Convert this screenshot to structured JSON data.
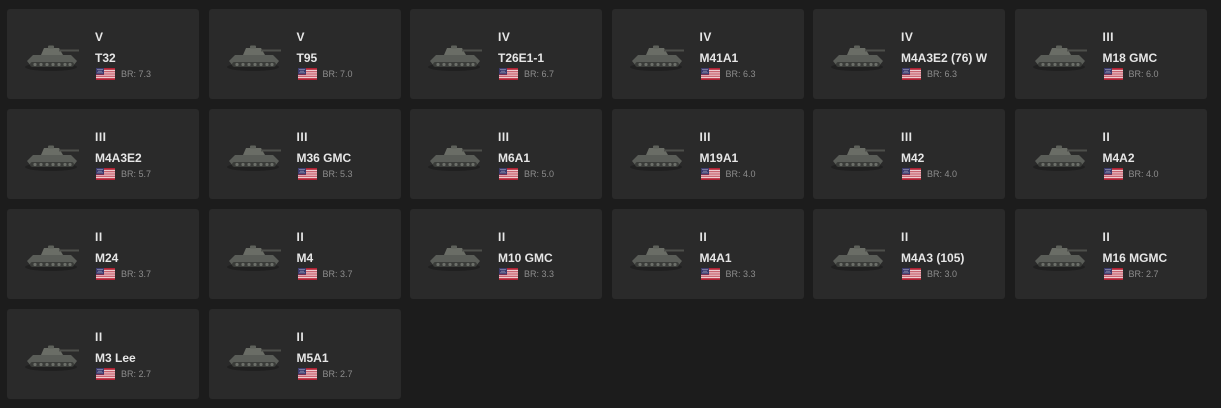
{
  "vehicles": [
    {
      "tier": "V",
      "name": "T32",
      "br": "BR: 7.3",
      "icon": "tank-icon",
      "nation": "us-flag-icon"
    },
    {
      "tier": "V",
      "name": "T95",
      "br": "BR: 7.0",
      "icon": "tank-icon",
      "nation": "us-flag-icon"
    },
    {
      "tier": "IV",
      "name": "T26E1-1",
      "br": "BR: 6.7",
      "icon": "tank-icon",
      "nation": "us-flag-icon"
    },
    {
      "tier": "IV",
      "name": "M41A1",
      "br": "BR: 6.3",
      "icon": "tank-icon",
      "nation": "us-flag-icon"
    },
    {
      "tier": "IV",
      "name": "M4A3E2 (76) W",
      "br": "BR: 6.3",
      "icon": "tank-icon",
      "nation": "us-flag-icon"
    },
    {
      "tier": "III",
      "name": "M18 GMC",
      "br": "BR: 6.0",
      "icon": "tank-icon",
      "nation": "us-flag-icon"
    },
    {
      "tier": "III",
      "name": "M4A3E2",
      "br": "BR: 5.7",
      "icon": "tank-icon",
      "nation": "us-flag-icon"
    },
    {
      "tier": "III",
      "name": "M36 GMC",
      "br": "BR: 5.3",
      "icon": "tank-icon",
      "nation": "us-flag-icon"
    },
    {
      "tier": "III",
      "name": "M6A1",
      "br": "BR: 5.0",
      "icon": "tank-icon",
      "nation": "us-flag-icon"
    },
    {
      "tier": "III",
      "name": "M19A1",
      "br": "BR: 4.0",
      "icon": "tank-icon",
      "nation": "us-flag-icon"
    },
    {
      "tier": "III",
      "name": "M42",
      "br": "BR: 4.0",
      "icon": "tank-icon",
      "nation": "us-flag-icon"
    },
    {
      "tier": "II",
      "name": "M4A2",
      "br": "BR: 4.0",
      "icon": "tank-icon",
      "nation": "us-flag-icon"
    },
    {
      "tier": "II",
      "name": "M24",
      "br": "BR: 3.7",
      "icon": "tank-icon",
      "nation": "us-flag-icon"
    },
    {
      "tier": "II",
      "name": "M4",
      "br": "BR: 3.7",
      "icon": "tank-icon",
      "nation": "us-flag-icon"
    },
    {
      "tier": "II",
      "name": "M10 GMC",
      "br": "BR: 3.3",
      "icon": "tank-icon",
      "nation": "us-flag-icon"
    },
    {
      "tier": "II",
      "name": "M4A1",
      "br": "BR: 3.3",
      "icon": "tank-icon",
      "nation": "us-flag-icon"
    },
    {
      "tier": "II",
      "name": "M4A3 (105)",
      "br": "BR: 3.0",
      "icon": "tank-icon",
      "nation": "us-flag-icon"
    },
    {
      "tier": "II",
      "name": "M16 MGMC",
      "br": "BR: 2.7",
      "icon": "tank-icon",
      "nation": "us-flag-icon"
    },
    {
      "tier": "II",
      "name": "M3 Lee",
      "br": "BR: 2.7",
      "icon": "tank-icon",
      "nation": "us-flag-icon"
    },
    {
      "tier": "II",
      "name": "M5A1",
      "br": "BR: 2.7",
      "icon": "tank-icon",
      "nation": "us-flag-icon"
    }
  ],
  "colors": {
    "background": "#1c1c1c",
    "card": "#2a2a2a",
    "text": "#e6e6e6",
    "muted": "#8d8d8d"
  }
}
